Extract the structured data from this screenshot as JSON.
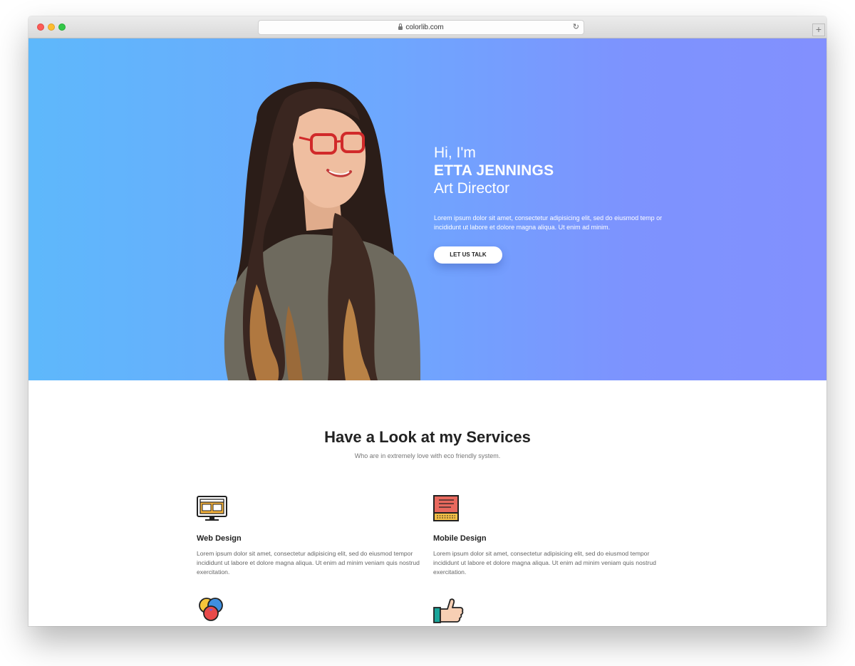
{
  "browser": {
    "url": "colorlib.com"
  },
  "hero": {
    "greeting": "Hi, I'm",
    "name": "ETTA JENNINGS",
    "role": "Art Director",
    "description": "Lorem ipsum dolor sit amet, consectetur adipisicing elit, sed do eiusmod temp or incididunt ut labore et dolore magna aliqua. Ut enim ad minim.",
    "cta_label": "LET US TALK"
  },
  "services": {
    "title": "Have a Look at my Services",
    "subtitle": "Who are in extremely love with eco friendly system.",
    "items": [
      {
        "icon": "monitor-icon",
        "title": "Web Design",
        "desc": "Lorem ipsum dolor sit amet, consectetur adipisicing elit, sed do eiusmod tempor incididunt ut labore et dolore magna aliqua. Ut enim ad minim veniam quis nostrud exercitation."
      },
      {
        "icon": "notebook-icon",
        "title": "Mobile Design",
        "desc": "Lorem ipsum dolor sit amet, consectetur adipisicing elit, sed do eiusmod tempor incididunt ut labore et dolore magna aliqua. Ut enim ad minim veniam quis nostrud exercitation."
      },
      {
        "icon": "color-circles-icon"
      },
      {
        "icon": "thumbs-up-icon"
      }
    ]
  },
  "colors": {
    "hero_gradient_start": "#5eb8fb",
    "hero_gradient_end": "#8290fe"
  }
}
